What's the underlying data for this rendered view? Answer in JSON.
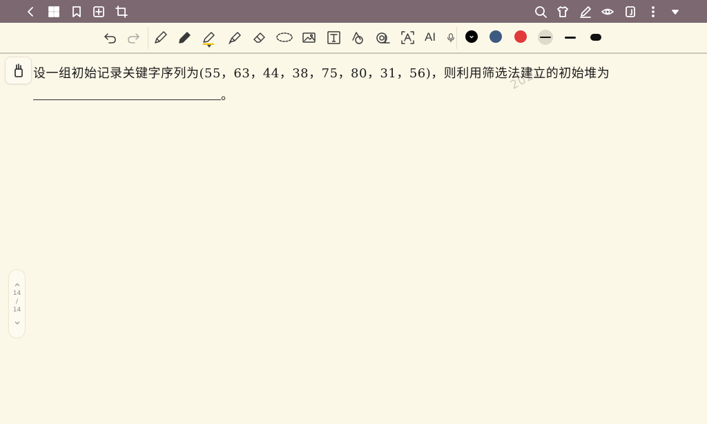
{
  "topbar": {
    "left_icons": [
      "back-icon",
      "grid-icon",
      "bookmark-icon",
      "add-page-icon",
      "crop-icon"
    ],
    "right_icons": [
      "search-icon",
      "shirt-icon",
      "pen-sign-icon",
      "eye-icon",
      "book-icon",
      "more-icon",
      "dropdown-icon"
    ]
  },
  "toolbar": {
    "tools": [
      "undo-icon",
      "redo-icon",
      "fountain-pen-icon",
      "pencil-icon",
      "marker-icon",
      "highlighter-icon",
      "eraser-icon",
      "lasso-icon",
      "image-icon",
      "textbox-icon",
      "shape-icon",
      "tape-icon",
      "ocr-icon",
      "ai-icon",
      "microphone-icon"
    ],
    "ai_label": "AI",
    "colors": [
      "#000000",
      "#3d5a80",
      "#e03a3a"
    ],
    "stroke_sizes": [
      "thin",
      "medium",
      "thick"
    ],
    "active_highlight_color": "#f2c200"
  },
  "content": {
    "question": "设一组初始记录关键字序列为(55，63，44，38，75，80，31，56)，则利用筛选法建立的初始堆为",
    "period": "。",
    "watermark": "2022"
  },
  "page_nav": {
    "current": "14",
    "separator": "/",
    "total": "14"
  }
}
